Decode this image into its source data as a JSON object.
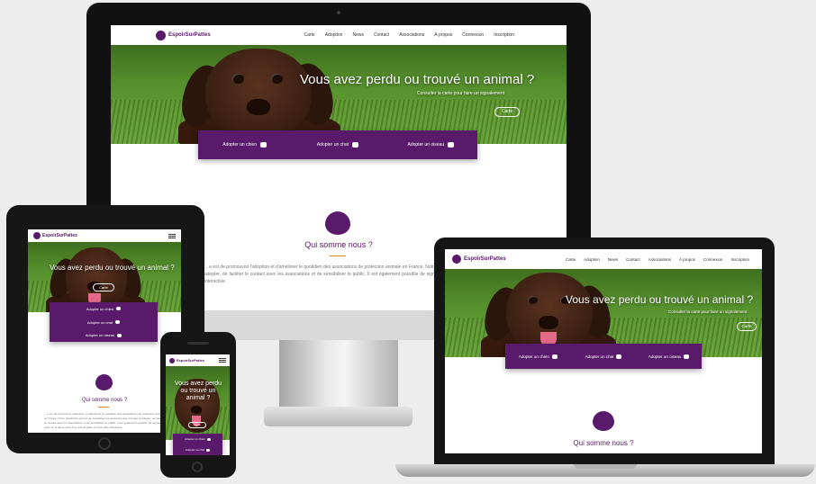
{
  "brand": {
    "name": "EspoirSurPattes"
  },
  "menu": [
    "Carte",
    "Adoption",
    "News",
    "Contact",
    "Associations",
    "À propos",
    "Connexion",
    "Inscription"
  ],
  "hero": {
    "title": "Vous avez perdu ou trouvé un animal ?",
    "subtitle": "Consulter la carte pour faire un signalement",
    "button": "Carte"
  },
  "adopt": [
    {
      "label": "Adopter un chien",
      "icon": "dog-icon"
    },
    {
      "label": "Adopter un chat",
      "icon": "cat-icon"
    },
    {
      "label": "Adopter un oiseau",
      "icon": "bird-icon"
    }
  ],
  "about": {
    "title": "Qui somme nous ?",
    "text": "…e est de promouvoir l'adoption et d'améliorer le quotidien des associations de protection animale en France. Notre plateforme permet de centraliser les annonces des animaux à adopter, de faciliter le contact avec les associations et de sensibiliser le public. Il est également possible de signaler la perte ou la découverte d'un animal grâce à notre carte interactive."
  },
  "colors": {
    "primary": "#5a1a6b",
    "accent": "#e0802a"
  }
}
